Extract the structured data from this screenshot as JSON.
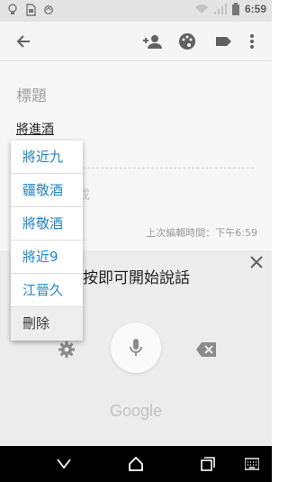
{
  "status_bar": {
    "time": "6:59",
    "icons": [
      "lightbulb-icon",
      "sim-icon",
      "sync-icon",
      "wifi-icon",
      "signal-icon",
      "battery-icon"
    ]
  },
  "toolbar": {
    "icons": [
      "back-arrow-icon",
      "add-person-icon",
      "palette-icon",
      "label-icon",
      "more-vert-icon"
    ]
  },
  "note": {
    "title_placeholder": "標題",
    "text": "將進酒",
    "partial_text": "戌",
    "edited": "上次編輯時間：下午6:59"
  },
  "suggestions": {
    "items": [
      "將近九",
      "疆敬酒",
      "將敬酒",
      "將近9",
      "江晉久"
    ],
    "delete_label": "刪除"
  },
  "voice": {
    "prompt": "按即可開始說話",
    "logo": "Google"
  },
  "colors": {
    "suggestion_text": "#1e86c8",
    "status_bar": "#e4e4e4",
    "voice_panel": "#ececec"
  }
}
